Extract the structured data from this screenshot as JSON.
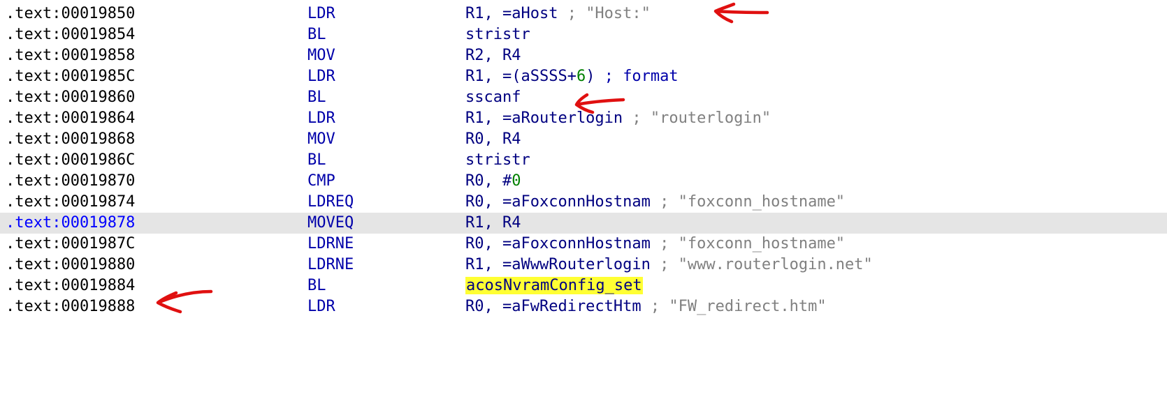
{
  "listing": {
    "lines": [
      {
        "address": ".text:00019850",
        "mnemonic": "LDR",
        "operand": "R1, =aHost",
        "comment": " ; \"Host:\""
      },
      {
        "address": ".text:00019854",
        "mnemonic": "BL",
        "operand": "stristr",
        "comment": ""
      },
      {
        "address": ".text:00019858",
        "mnemonic": "MOV",
        "operand": "R2, R4",
        "comment": ""
      },
      {
        "address": ".text:0001985C",
        "mnemonic": "LDR",
        "operand": "R1, =(aSSSS+",
        "number": "6",
        "operand_tail": ")",
        "comment": " ; format"
      },
      {
        "address": ".text:00019860",
        "mnemonic": "BL",
        "operand": "sscanf",
        "comment": ""
      },
      {
        "address": ".text:00019864",
        "mnemonic": "LDR",
        "operand": "R1, =aRouterlogin",
        "comment": " ; \"routerlogin\""
      },
      {
        "address": ".text:00019868",
        "mnemonic": "MOV",
        "operand": "R0, R4",
        "comment": ""
      },
      {
        "address": ".text:0001986C",
        "mnemonic": "BL",
        "operand": "stristr",
        "comment": ""
      },
      {
        "address": ".text:00019870",
        "mnemonic": "CMP",
        "operand": "R0, #",
        "number": "0",
        "comment": ""
      },
      {
        "address": ".text:00019874",
        "mnemonic": "LDREQ",
        "operand": "R0, =aFoxconnHostnam",
        "comment": " ; \"foxconn_hostname\""
      },
      {
        "address": ".text:00019878",
        "mnemonic": "MOVEQ",
        "operand": "R1, R4",
        "comment": "",
        "current": true
      },
      {
        "address": ".text:0001987C",
        "mnemonic": "LDRNE",
        "operand": "R0, =aFoxconnHostnam",
        "comment": " ; \"foxconn_hostname\""
      },
      {
        "address": ".text:00019880",
        "mnemonic": "LDRNE",
        "operand": "R1, =aWwwRouterlogin",
        "comment": " ; \"www.routerlogin.net\""
      },
      {
        "address": ".text:00019884",
        "mnemonic": "BL",
        "operand": "acosNvramConfig_set",
        "comment": "",
        "highlight": true
      },
      {
        "address": ".text:00019888",
        "mnemonic": "LDR",
        "operand": "R0, =aFwRedirectHtm",
        "comment": " ; \"FW_redirect.htm\""
      }
    ]
  },
  "colors": {
    "mnemonic": "#0000aa",
    "operand": "#000080",
    "number": "#008000",
    "comment": "#808080",
    "current_line_bg": "#e5e5e5",
    "current_address": "#0000ff",
    "highlight_bg": "#ffff33",
    "annotation_arrow": "#e01010"
  },
  "annotations": {
    "arrows": [
      {
        "points_to": "Host: comment at 00019850"
      },
      {
        "points_to": "sscanf at 00019860"
      },
      {
        "points_to": "address 00019884"
      }
    ]
  }
}
